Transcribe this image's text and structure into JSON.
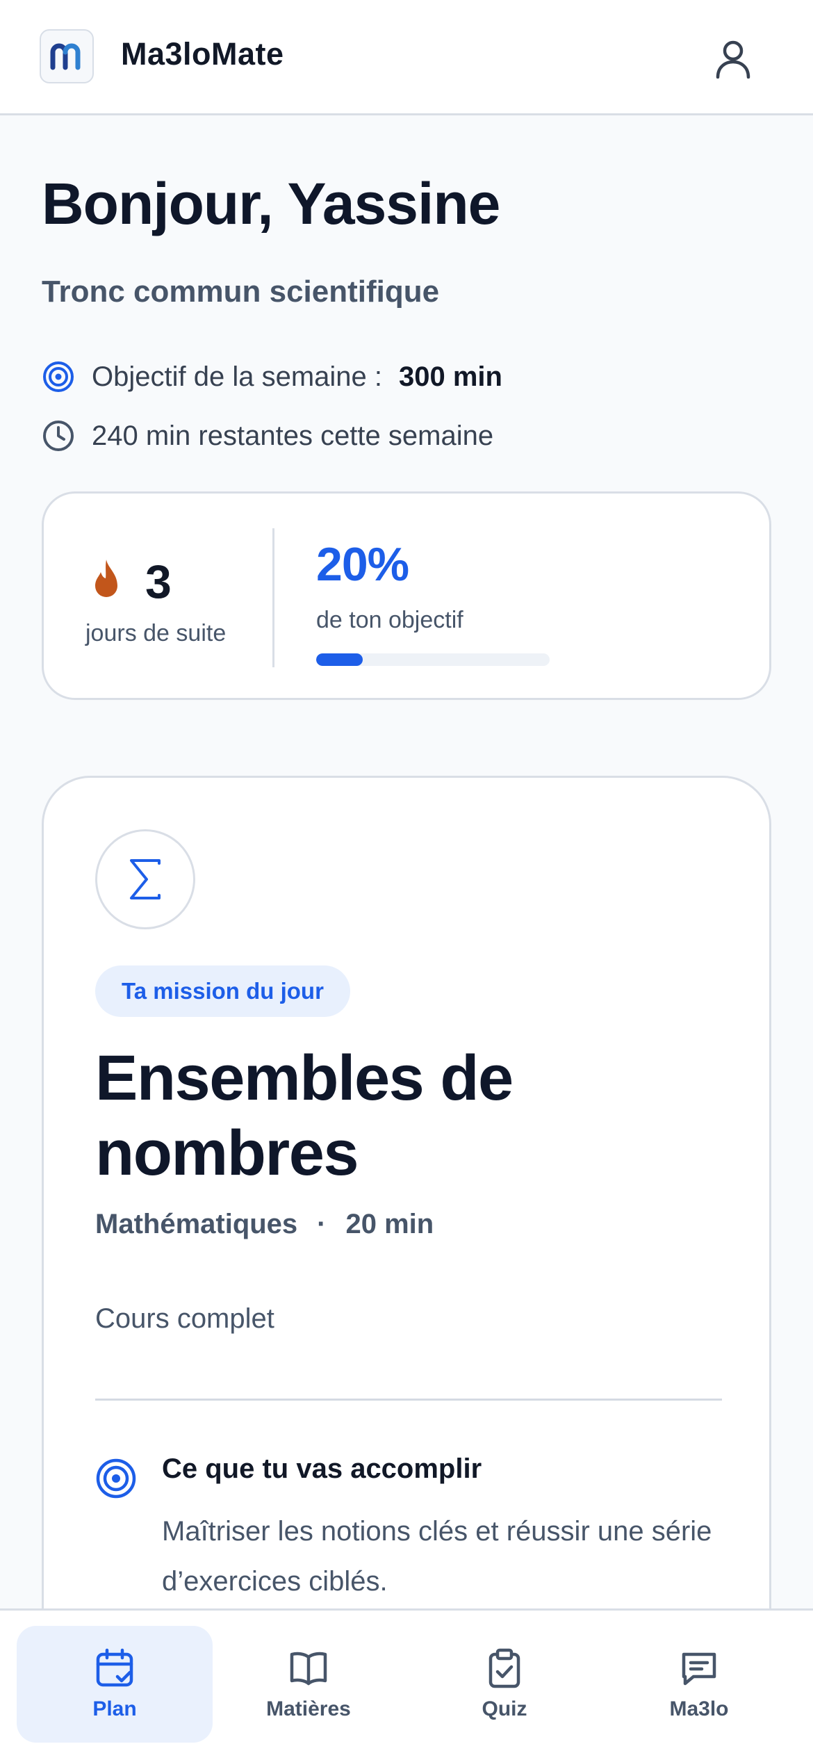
{
  "header": {
    "app_name": "Ma3loMate",
    "logo_icon": "m-logo-icon",
    "profile_icon": "user-icon"
  },
  "greeting": {
    "title": "Bonjour, Yassine",
    "track": "Tronc commun scientifique",
    "goal_label": "Objectif de la semaine :",
    "goal_value": "300 min",
    "remaining": "240 min restantes cette semaine"
  },
  "stats": {
    "streak_value": "3",
    "streak_label": "jours de suite",
    "progress_value": "20%",
    "progress_label": "de ton objectif",
    "progress_fraction": 0.2
  },
  "mission": {
    "pill": "Ta mission du jour",
    "title": "Ensembles de nombres",
    "subject": "Mathématiques",
    "separator": "·",
    "duration": "20 min",
    "type": "Cours complet",
    "goal_title": "Ce que tu vas accomplir",
    "goal_desc": "Maîtriser les notions clés et réussir une série d’exercices ciblés."
  },
  "nav": {
    "items": [
      {
        "label": "Plan",
        "icon": "calendar-icon",
        "active": true
      },
      {
        "label": "Matières",
        "icon": "book-icon",
        "active": false
      },
      {
        "label": "Quiz",
        "icon": "clipboard-check-icon",
        "active": false
      },
      {
        "label": "Ma3lo",
        "icon": "chat-icon",
        "active": false
      }
    ]
  },
  "colors": {
    "accent": "#1d5ee8",
    "flame": "#c2561b",
    "text_dark": "#0f172a",
    "text_muted": "#475569"
  }
}
